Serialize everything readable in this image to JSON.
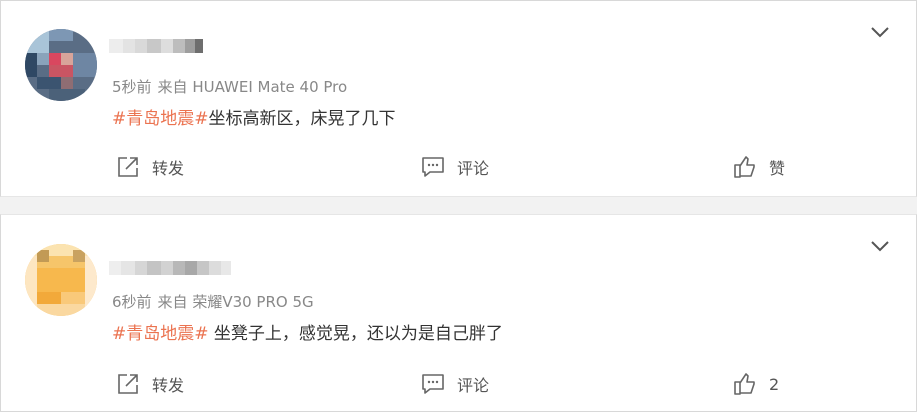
{
  "comments": [
    {
      "username": "",
      "time": "5秒前",
      "source": "来自 HUAWEI Mate 40 Pro",
      "hashtag": "#青岛地震#",
      "text": "坐标高新区，床晃了几下",
      "actions": {
        "forward": "转发",
        "comment": "评论",
        "like": "赞"
      }
    },
    {
      "username": "",
      "time": "6秒前",
      "source": "来自 荣耀V30 PRO 5G",
      "hashtag": "#青岛地震#",
      "text": " 坐凳子上，感觉晃，还以为是自己胖了",
      "actions": {
        "forward": "转发",
        "comment": "评论",
        "like": "2"
      }
    }
  ],
  "colors": {
    "hashtag": "#eb7350",
    "meta": "#888888",
    "icon": "#666666"
  },
  "icons": [
    "chevron-down-icon",
    "forward-icon",
    "comment-icon",
    "thumbs-up-icon"
  ]
}
